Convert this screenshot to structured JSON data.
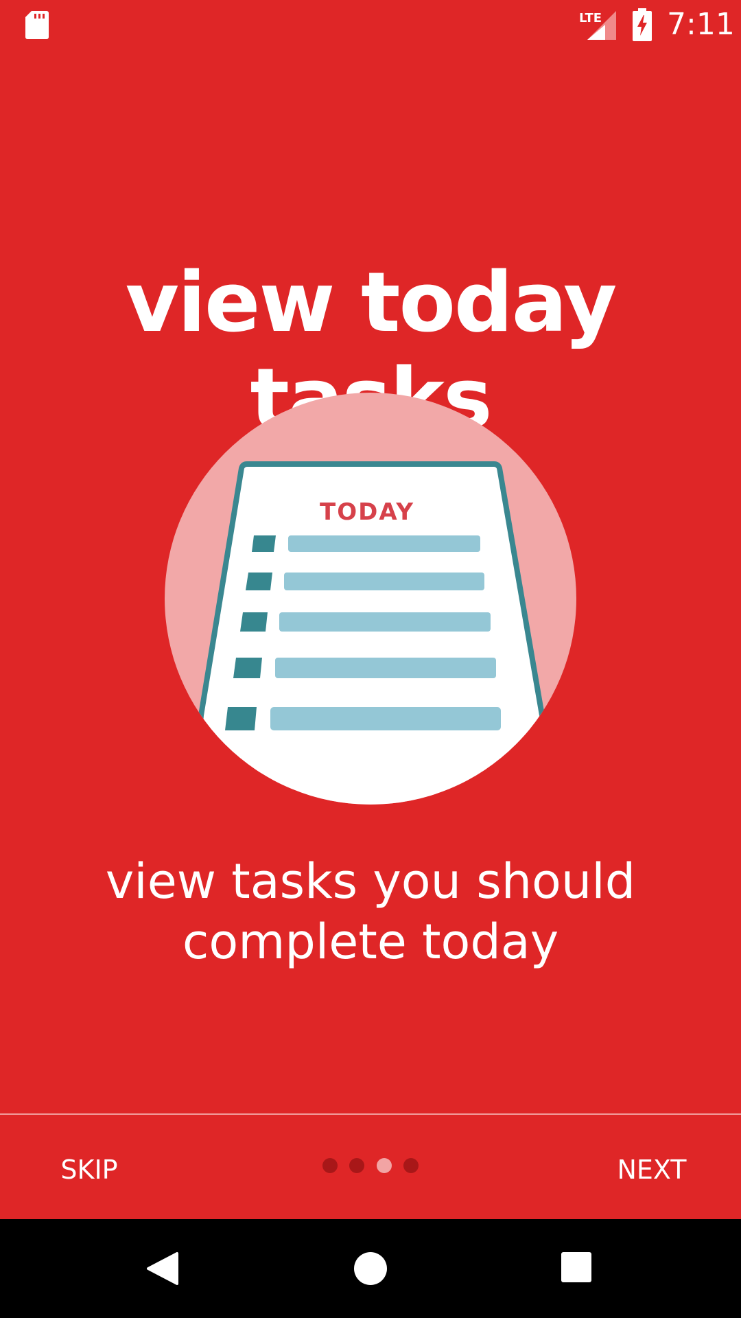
{
  "status_bar": {
    "time": "7:11",
    "network_label": "LTE",
    "icons": [
      "sd-card-icon",
      "lte-signal-icon",
      "battery-charging-icon"
    ]
  },
  "onboarding": {
    "title": "view today tasks",
    "illustration_label": "TODAY",
    "description_line1": "view tasks you should",
    "description_line2": "complete today"
  },
  "footer": {
    "skip_label": "SKIP",
    "next_label": "NEXT",
    "page_count": 4,
    "active_page": 3
  },
  "nav_bar": {
    "icons": [
      "back-icon",
      "home-icon",
      "recents-icon"
    ]
  },
  "colors": {
    "background": "#df2627",
    "circle": "#f2a8a8",
    "paper_border": "#3a8790",
    "checkbox": "#37878f",
    "line": "#94c7d6",
    "today_text": "#d6414a",
    "dot_inactive": "#a81718",
    "dot_active": "#f2a4a4",
    "nav_bar": "#000000"
  }
}
